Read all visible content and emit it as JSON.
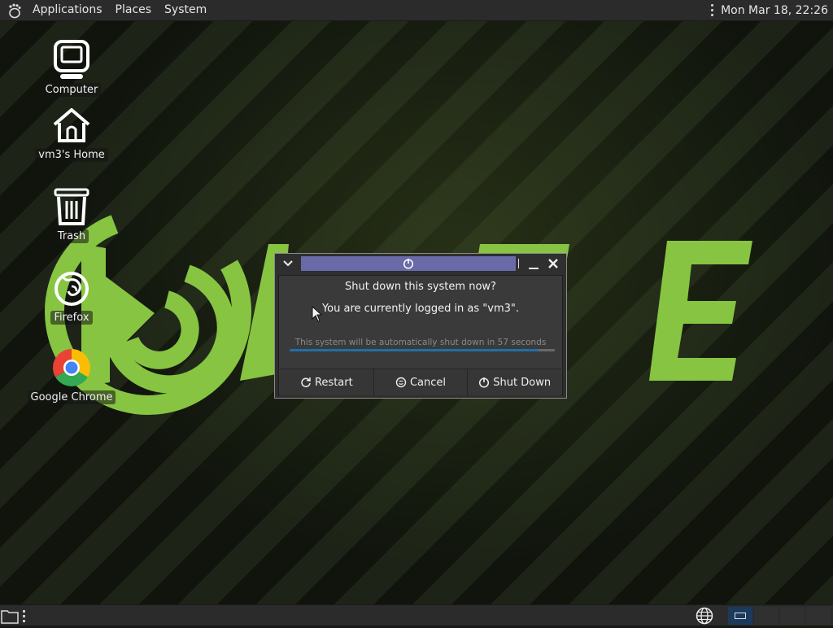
{
  "top_panel": {
    "menus": [
      "Applications",
      "Places",
      "System"
    ],
    "clock": "Mon Mar 18, 22:26"
  },
  "desktop": {
    "icons": [
      {
        "label": "Computer",
        "icon": "computer-icon"
      },
      {
        "label": "vm3's Home",
        "icon": "home-folder-icon"
      },
      {
        "label": "Trash",
        "icon": "trash-icon"
      },
      {
        "label": "Firefox",
        "icon": "firefox-icon"
      },
      {
        "label": "Google Chrome",
        "icon": "chrome-icon"
      }
    ]
  },
  "dialog": {
    "title_icon": "power-icon",
    "heading": "Shut down this system now?",
    "message": "You are currently logged in as \"vm3\".",
    "countdown": "This system will be automatically shut down in 57 seconds",
    "progress_fraction": 0.94,
    "buttons": {
      "restart": "Restart",
      "cancel": "Cancel",
      "shutdown": "Shut Down"
    }
  },
  "colors": {
    "mate_green": "#87c442",
    "panel": "#2b2b2b",
    "dialog_title": "#6a6aa8",
    "progress": "#1f6fa8"
  }
}
